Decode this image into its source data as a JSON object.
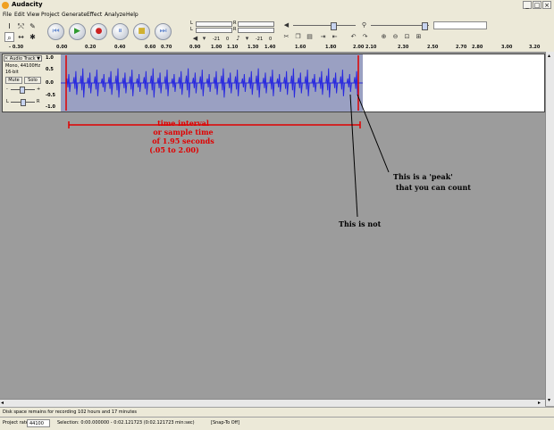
{
  "window": {
    "title": "Audacity",
    "min": "_",
    "max": "□",
    "close": "×"
  },
  "menu": [
    "File",
    "Edit",
    "View",
    "Project",
    "Generate",
    "Effect",
    "Analyze",
    "Help"
  ],
  "toolbar": {
    "tools": {
      "select": "I",
      "envelope": "⤲",
      "draw": "✎",
      "zoom": "⌕",
      "timeshift": "↔",
      "multi": "✱"
    },
    "transport": {
      "skip_start": "⏮",
      "play": "▶",
      "record": "●",
      "pause": "⏸",
      "stop": "■",
      "skip_end": "⏭"
    },
    "meters": {
      "left_top": "L",
      "right_top": "R",
      "left_bot": "L",
      "right_bot": "R",
      "db1": "-21",
      "db2": "0",
      "db3": "-21",
      "db4": "0"
    },
    "colors": {
      "play": "#2f9a2f",
      "record": "#cc2222",
      "accent": "#6d8fd0"
    }
  },
  "ruler": {
    "labels": [
      "- 0.30",
      "0.00",
      "0.20",
      "0.40",
      "0.60",
      "0.70",
      "0.90",
      "1.00",
      "1.10",
      "1.30",
      "1.40",
      "1.60",
      "1.80",
      "2.00",
      "2.10",
      "2.30",
      "2.50",
      "2.70",
      "2.80",
      "3.00",
      "3.20"
    ]
  },
  "track": {
    "name": "Audio Track",
    "info1": "Mono, 44100Hz",
    "info2": "16-bit",
    "mute": "Mute",
    "solo": "Solo",
    "gain_minus": "-",
    "gain_plus": "+",
    "pan_l": "L",
    "pan_r": "R",
    "vscale": [
      "1.0",
      "0.5",
      "0.0",
      "-0.5",
      "-1.0"
    ]
  },
  "annotations": {
    "interval_line1": "time interval",
    "interval_line2": "or sample time",
    "interval_line3": "of 1.95 seconds",
    "interval_line4": "(.05 to 2.00)",
    "peak_line1": "This is a 'peak'",
    "peak_line2": "that you can count",
    "not": "This is not"
  },
  "status": {
    "disk": "Disk space remains for recording 102 hours and 17 minutes",
    "rate_label": "Project rate:",
    "rate_value": "44100",
    "selection": "Selection: 0:00.000000 - 0:02.121723 (0:02.121723 min:sec)",
    "snap": "[Snap-To Off]"
  }
}
